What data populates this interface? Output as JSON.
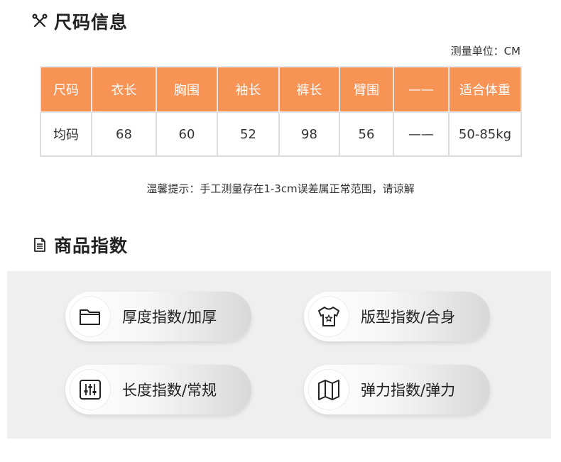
{
  "size_section": {
    "title": "尺码信息",
    "unit": "测量单位：CM",
    "headers": [
      "尺码",
      "衣长",
      "胸围",
      "袖长",
      "裤长",
      "臂围",
      "——",
      "适合体重"
    ],
    "row": [
      "均码",
      "68",
      "60",
      "52",
      "98",
      "56",
      "——",
      "50-85kg"
    ],
    "tip": "温馨提示：手工测量存在1-3cm误差属正常范围，请谅解",
    "colors": {
      "header_bg": "#f79355",
      "border": "#dcdcdc"
    }
  },
  "index_section": {
    "title": "商品指数",
    "items": [
      {
        "icon": "folder-icon",
        "label": "厚度指数/加厚"
      },
      {
        "icon": "tshirt-icon",
        "label": "版型指数/合身"
      },
      {
        "icon": "sliders-icon",
        "label": "长度指数/常规"
      },
      {
        "icon": "folded-map-icon",
        "label": "弹力指数/弹力"
      }
    ],
    "colors": {
      "panel_bg": "#efefef"
    }
  }
}
